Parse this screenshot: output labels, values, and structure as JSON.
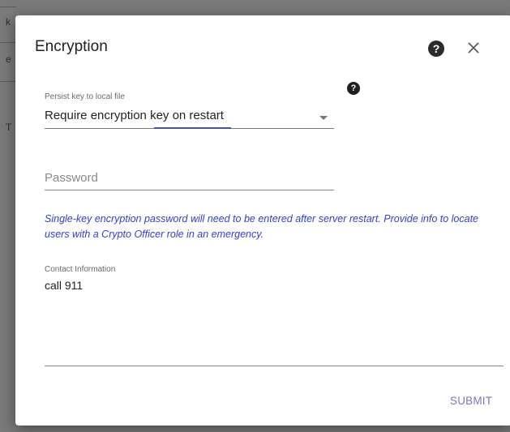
{
  "backdrop": {
    "chars": [
      "k",
      "e",
      "T"
    ]
  },
  "dialog": {
    "title": "Encryption",
    "help_icon": "?",
    "close_icon": "close-icon"
  },
  "persist_select": {
    "label": "Persist key to local file",
    "value": "Require encryption key on restart",
    "help_icon": "?"
  },
  "password": {
    "placeholder": "Password",
    "value": ""
  },
  "info": {
    "text": "Single-key encryption password will need to be entered after server restart. Provide info to locate users with a Crypto Officer role in an emergency."
  },
  "contact": {
    "label": "Contact Information",
    "value": "call 911"
  },
  "actions": {
    "submit_label": "SUBMIT"
  },
  "colors": {
    "accent": "#3f51b5",
    "info_text": "#2f3fd1",
    "submit_text": "#7e75bd"
  }
}
